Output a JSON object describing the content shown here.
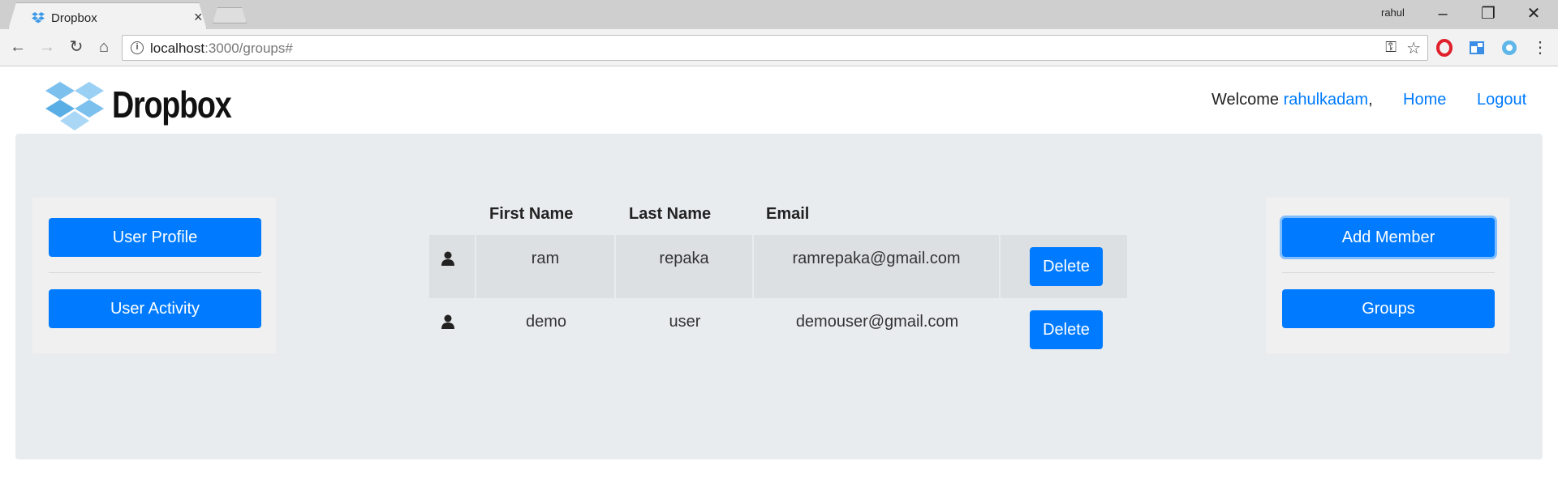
{
  "browser": {
    "tab_title": "Dropbox",
    "tab_close": "×",
    "profile_name": "rahul",
    "url_host": "localhost",
    "url_rest": ":3000/groups#"
  },
  "header": {
    "logo_text": "Dropbox",
    "welcome_label": "Welcome",
    "username": "rahulkadam",
    "comma": ",",
    "nav": {
      "home": "Home",
      "logout": "Logout"
    }
  },
  "left_menu": {
    "user_profile": "User Profile",
    "user_activity": "User Activity"
  },
  "right_menu": {
    "add_member": "Add Member",
    "groups": "Groups"
  },
  "table": {
    "headers": {
      "first_name": "First Name",
      "last_name": "Last Name",
      "email": "Email"
    },
    "rows": [
      {
        "first_name": "ram",
        "last_name": "repaka",
        "email": "ramrepaka@gmail.com",
        "action": "Delete"
      },
      {
        "first_name": "demo",
        "last_name": "user",
        "email": "demouser@gmail.com",
        "action": "Delete"
      }
    ]
  },
  "colors": {
    "primary": "#007bff",
    "panel_bg": "#e9ecef",
    "row_shade": "#dde0e3"
  }
}
